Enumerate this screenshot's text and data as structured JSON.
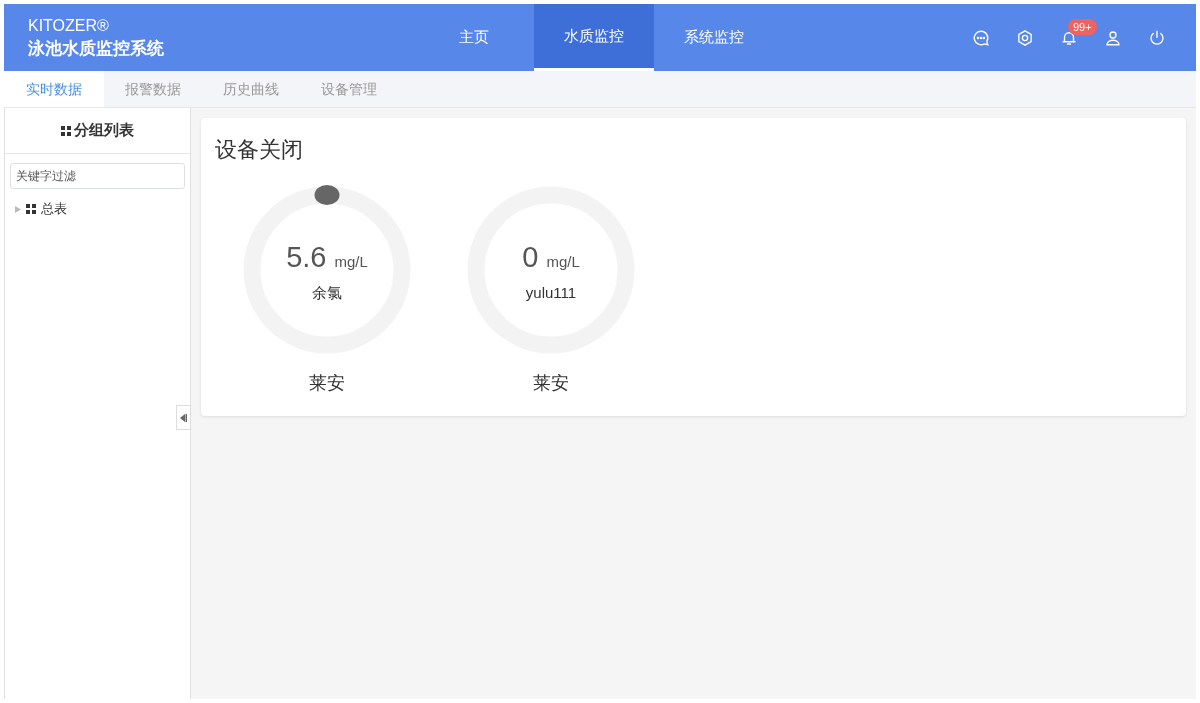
{
  "brand": {
    "name": "KITOZER®",
    "title": "泳池水质监控系统"
  },
  "nav": [
    {
      "label": "主页",
      "selected": false
    },
    {
      "label": "水质监控",
      "selected": true
    },
    {
      "label": "系统监控",
      "selected": false
    }
  ],
  "header_icons": [
    {
      "kind": "chat"
    },
    {
      "kind": "settings"
    },
    {
      "kind": "bell",
      "badge": "99+"
    },
    {
      "kind": "user"
    },
    {
      "kind": "power"
    }
  ],
  "tabs": [
    {
      "label": "实时数据",
      "selected": true
    },
    {
      "label": "报警数据",
      "selected": false
    },
    {
      "label": "历史曲线",
      "selected": false
    },
    {
      "label": "设备管理",
      "selected": false
    }
  ],
  "sidebar": {
    "title": "分组列表",
    "filter": {
      "placeholder": "关键字过滤"
    },
    "tree": [
      {
        "label": "总表",
        "expanded": false
      }
    ]
  },
  "panel": {
    "title": "设备关闭",
    "gauges": [
      {
        "value": "5.6",
        "unit": "mg/L",
        "name": "余氯",
        "location": "莱安",
        "marker": true
      },
      {
        "value": "0",
        "unit": "mg/L",
        "name": "yulu111",
        "location": "莱安",
        "marker": false
      }
    ]
  }
}
